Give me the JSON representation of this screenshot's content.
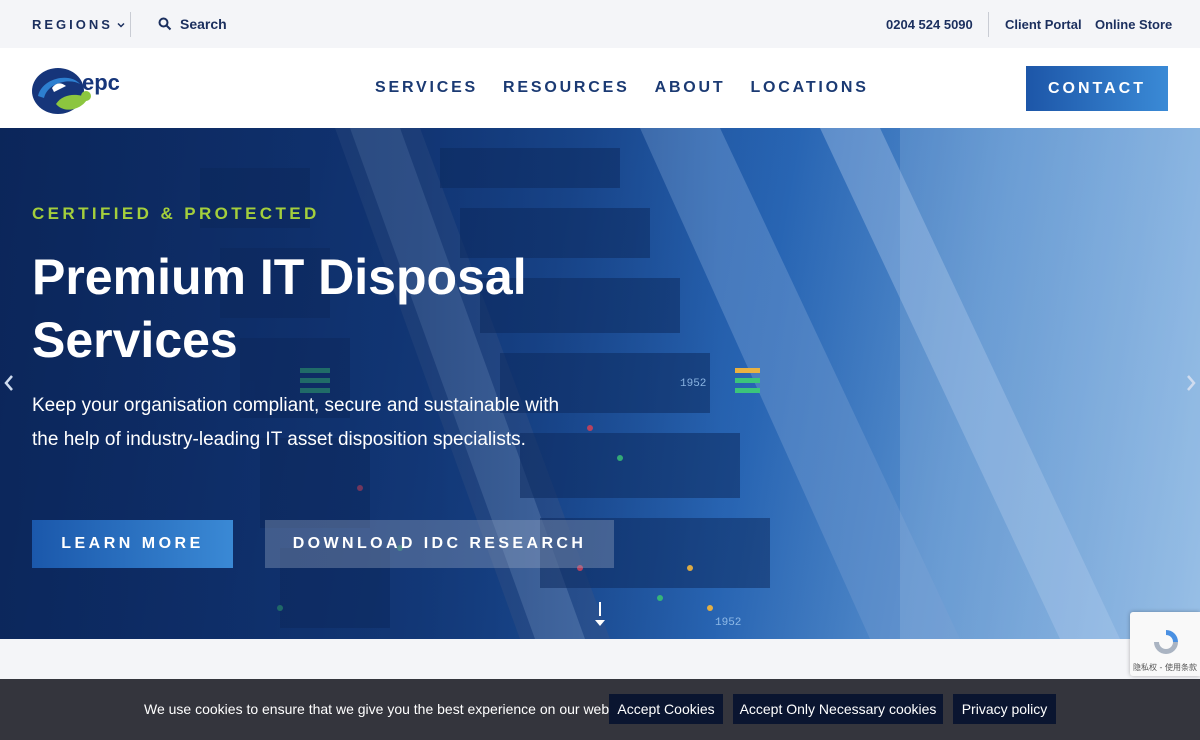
{
  "utility_bar": {
    "regions_label": "REGIONS",
    "search_label": "Search",
    "phone": "0204 524 5090",
    "client_portal": "Client Portal",
    "online_store": "Online Store"
  },
  "header": {
    "logo_text": "epc",
    "nav": [
      {
        "label": "SERVICES"
      },
      {
        "label": "RESOURCES"
      },
      {
        "label": "ABOUT"
      },
      {
        "label": "LOCATIONS"
      }
    ],
    "contact_label": "CONTACT"
  },
  "hero": {
    "eyebrow": "CERTIFIED & PROTECTED",
    "title": "Premium IT Disposal Services",
    "description": "Keep your organisation compliant, secure and sustainable with the help of industry-leading IT asset disposition specialists.",
    "learn_more_label": "LEARN MORE",
    "idc_label": "DOWNLOAD IDC RESEARCH",
    "rack_label": "1952"
  },
  "recaptcha": {
    "text": "隐私权 - 使用条款"
  },
  "cookie_bar": {
    "message": "We use cookies to ensure that we give you the best experience on our website.",
    "accept_label": "Accept Cookies",
    "necessary_label": "Accept Only Necessary cookies",
    "privacy_label": "Privacy policy"
  },
  "colors": {
    "navy": "#1b2f5e",
    "accent_green": "#a4cf3c",
    "button_blue": "#1d56a8",
    "cookie_bg": "#34353d"
  },
  "icons": {
    "regions": "chevron-down-icon",
    "search": "search-icon",
    "hero_prev": "chevron-left-icon",
    "hero_next": "chevron-right-icon",
    "scroll": "arrow-down-icon",
    "recaptcha": "recaptcha-icon"
  }
}
